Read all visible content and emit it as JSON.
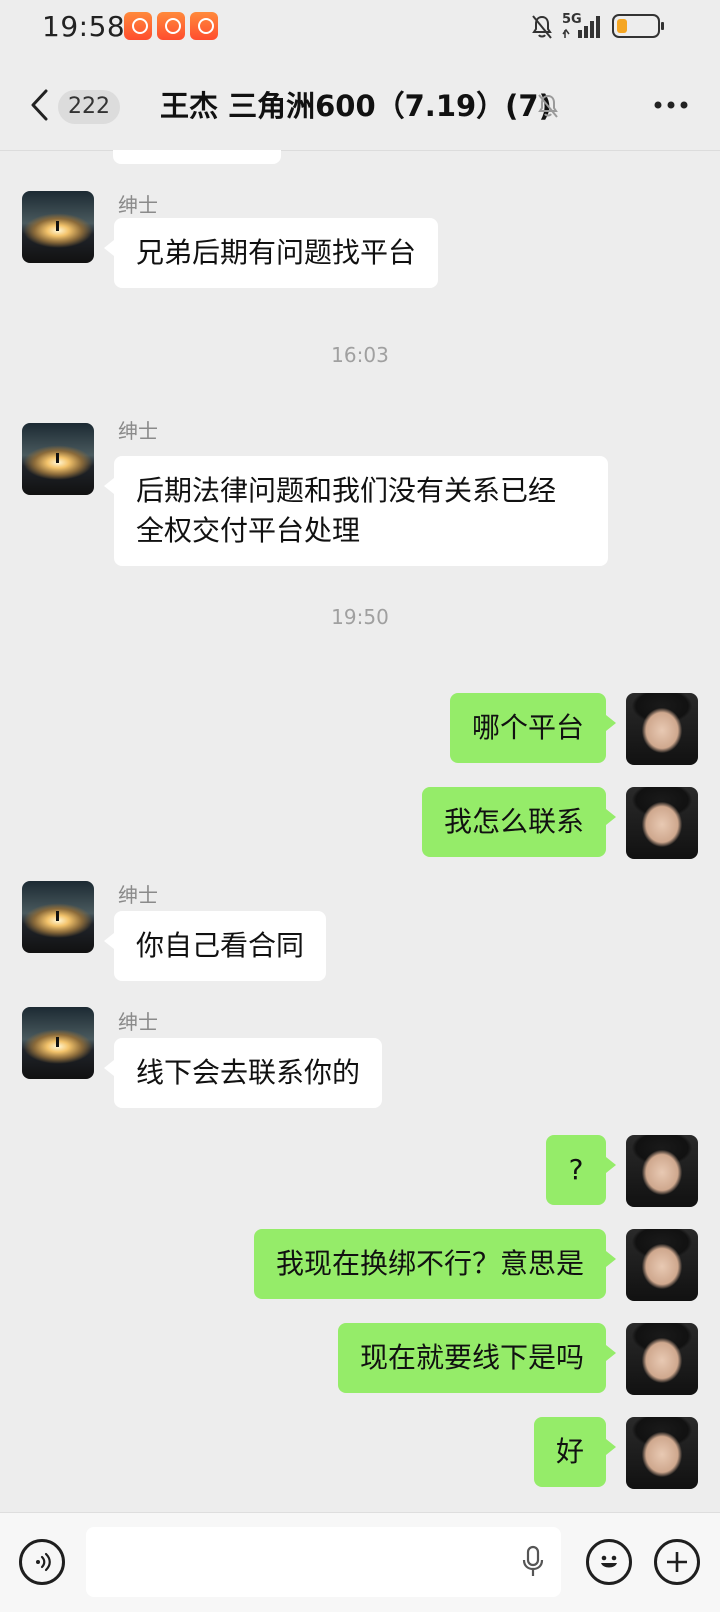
{
  "status_bar": {
    "time": "19:58",
    "network": "5G",
    "icons": [
      "app-notification-icon",
      "app-notification-icon",
      "app-notification-icon",
      "mute-icon",
      "signal-icon",
      "battery-icon"
    ]
  },
  "header": {
    "unread_count": "222",
    "title": "王杰 三角洲600（7.19）(7)",
    "muted": true
  },
  "messages": [
    {
      "type": "in",
      "sender": "绅士",
      "text": "兄弟后期有问题找平台"
    },
    {
      "type": "time",
      "text": "16:03"
    },
    {
      "type": "in",
      "sender": "绅士",
      "lines": [
        "后期法律问题和我们没有关系已经",
        "全权交付平台处理"
      ]
    },
    {
      "type": "time",
      "text": "19:50"
    },
    {
      "type": "out",
      "text": "哪个平台"
    },
    {
      "type": "out",
      "text": "我怎么联系"
    },
    {
      "type": "in",
      "sender": "绅士",
      "text": "你自己看合同"
    },
    {
      "type": "in",
      "sender": "绅士",
      "text": "线下会去联系你的"
    },
    {
      "type": "out",
      "text": "?"
    },
    {
      "type": "out",
      "text": "我现在换绑不行？意思是"
    },
    {
      "type": "out",
      "text": "现在就要线下是吗"
    },
    {
      "type": "out",
      "text": "好"
    }
  ],
  "colors": {
    "background": "#ededed",
    "outgoing_bubble": "#95ec69",
    "incoming_bubble": "#ffffff",
    "bottom_bar": "#f7f7f7"
  }
}
